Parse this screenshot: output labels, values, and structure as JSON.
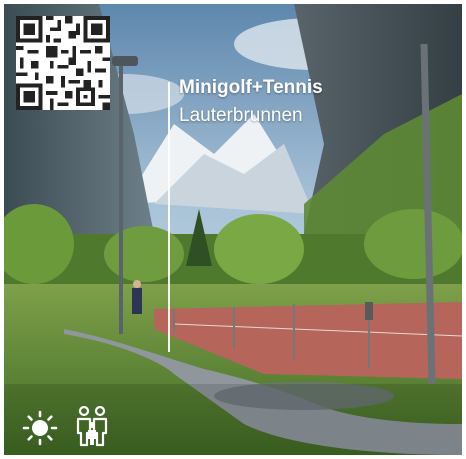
{
  "card": {
    "title": "Minigolf+Tennis",
    "subtitle": "Lauterbrunnen"
  },
  "icons": {
    "qr": "qr-code-icon",
    "weather": "sun-icon",
    "audience": "family-icon"
  },
  "colors": {
    "text": "#ffffff",
    "sky": "#7ea6c9",
    "tennis_court": "#b5655a",
    "grass": "#5e8a35"
  }
}
